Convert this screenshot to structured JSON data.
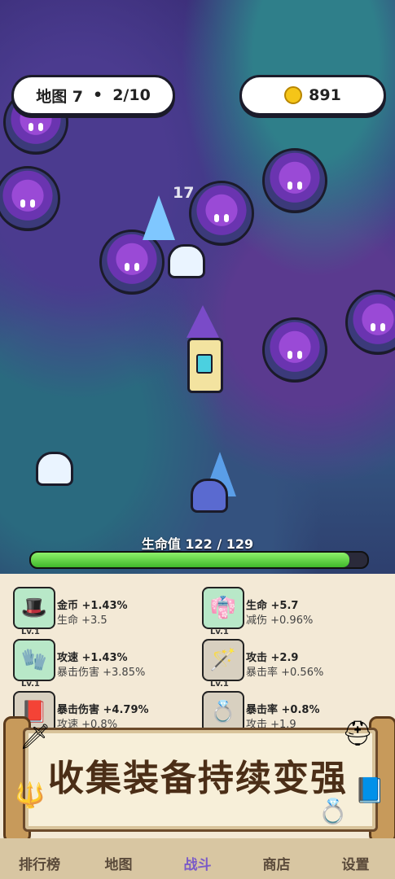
{
  "header": {
    "map_label": "地图 7",
    "separator": "•",
    "wave": "2/10",
    "coins": "891"
  },
  "battle": {
    "damage_number": "17",
    "hp_label": "生命值",
    "hp_value": "122 / 129",
    "hp_fraction": 0.946
  },
  "equipment": [
    {
      "icon": "wizard-hat-icon",
      "glyph": "🎩",
      "bg": "#b8e8c8",
      "level": "Lv.1",
      "stat1": "金币 +1.43%",
      "stat2": "生命 +3.5"
    },
    {
      "icon": "robe-icon",
      "glyph": "👘",
      "bg": "#b8e8c8",
      "level": "Lv.1",
      "stat1": "生命 +5.7",
      "stat2": "减伤 +0.96%"
    },
    {
      "icon": "glove-icon",
      "glyph": "🧤",
      "bg": "#b8e8c8",
      "level": "Lv.1",
      "stat1": "攻速 +1.43%",
      "stat2": "暴击伤害 +3.85%"
    },
    {
      "icon": "staff-icon",
      "glyph": "🪄",
      "bg": "#d8d0c0",
      "level": "Lv.1",
      "stat1": "攻击 +2.9",
      "stat2": "暴击率 +0.56%"
    },
    {
      "icon": "spellbook-icon",
      "glyph": "📕",
      "bg": "#d8d0c0",
      "level": "",
      "stat1": "暴击伤害 +4.79%",
      "stat2": "攻速 +0.8%"
    },
    {
      "icon": "ring-icon",
      "glyph": "💍",
      "bg": "#d8d0c0",
      "level": "",
      "stat1": "暴击率 +0.8%",
      "stat2": "攻击 +1.9"
    }
  ],
  "banner": {
    "title": "收集装备持续变强"
  },
  "nav": [
    {
      "label": "排行榜",
      "icon": "leaderboard-icon"
    },
    {
      "label": "地图",
      "icon": "map-icon"
    },
    {
      "label": "战斗",
      "icon": "battle-icon",
      "active": true
    },
    {
      "label": "商店",
      "icon": "shop-icon"
    },
    {
      "label": "设置",
      "icon": "settings-icon"
    }
  ]
}
